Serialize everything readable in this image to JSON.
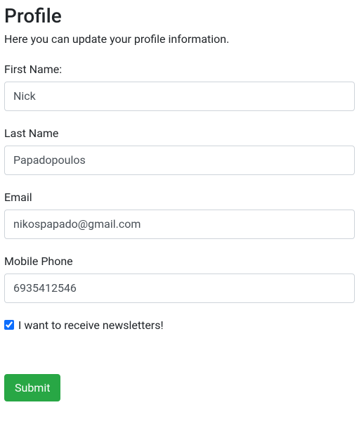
{
  "page": {
    "title": "Profile",
    "subtitle": "Here you can update your profile information."
  },
  "form": {
    "first_name": {
      "label": "First Name:",
      "value": "Nick"
    },
    "last_name": {
      "label": "Last Name",
      "value": "Papadopoulos"
    },
    "email": {
      "label": "Email",
      "value": "nikospapado@gmail.com"
    },
    "mobile": {
      "label": "Mobile Phone",
      "value": "6935412546"
    },
    "newsletter": {
      "label": "I want to receive newsletters!",
      "checked": true
    },
    "submit_label": "Submit"
  }
}
